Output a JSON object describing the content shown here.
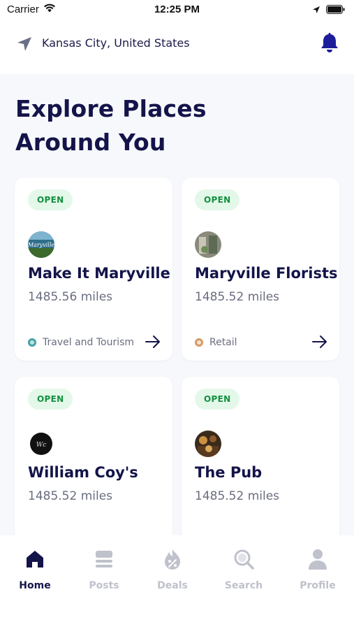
{
  "status_bar": {
    "carrier": "Carrier",
    "time": "12:25 PM"
  },
  "location": {
    "city": "Kansas City, United States"
  },
  "page": {
    "title_line1": "Explore Places",
    "title_line2": "Around You"
  },
  "places": [
    {
      "status": "OPEN",
      "name": "Make It Maryville",
      "distance": "1485.56 miles",
      "category": "Travel and Tourism",
      "category_color": "#4aa3a8"
    },
    {
      "status": "OPEN",
      "name": "Maryville Florists",
      "distance": "1485.52 miles",
      "category": "Retail",
      "category_color": "#d99b62"
    },
    {
      "status": "OPEN",
      "name": "William Coy's",
      "distance": "1485.52 miles"
    },
    {
      "status": "OPEN",
      "name": "The Pub",
      "distance": "1485.52 miles"
    }
  ],
  "tabs": [
    {
      "label": "Home",
      "icon": "home-icon",
      "active": true
    },
    {
      "label": "Posts",
      "icon": "posts-icon",
      "active": false
    },
    {
      "label": "Deals",
      "icon": "deals-icon",
      "active": false
    },
    {
      "label": "Search",
      "icon": "search-icon",
      "active": false
    },
    {
      "label": "Profile",
      "icon": "profile-icon",
      "active": false
    }
  ],
  "colors": {
    "primary": "#14144a",
    "open_badge_bg": "#e4f8e9",
    "open_badge_text": "#139040",
    "inactive_tab": "#bfc1cb",
    "background": "#f7f8fc"
  }
}
